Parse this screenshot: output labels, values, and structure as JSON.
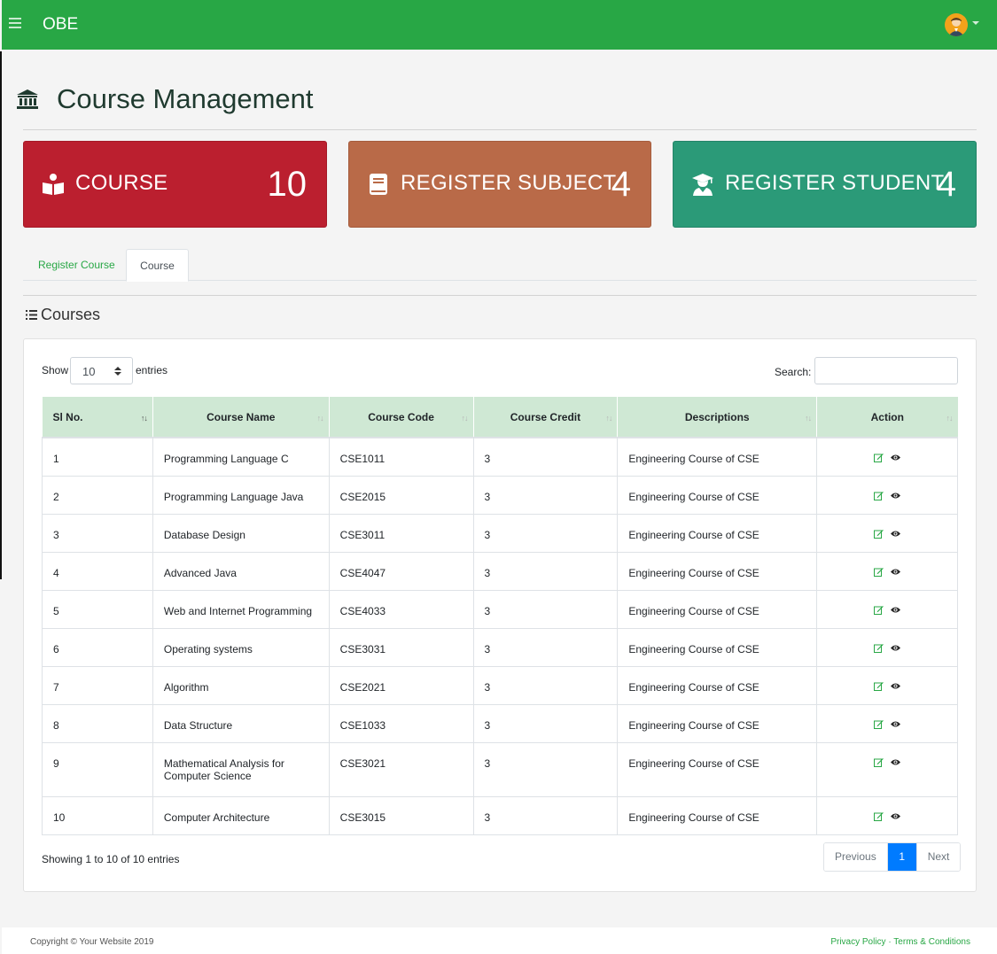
{
  "navbar": {
    "brand": "OBE",
    "menu_icon": "hamburger-icon",
    "avatar_icon": "user-avatar-icon"
  },
  "page": {
    "title": "Course Management",
    "title_icon": "bank-building-icon"
  },
  "cards": [
    {
      "label": "COURSE",
      "value": "10",
      "icon": "book-reader-icon",
      "color": "#bb1f2f"
    },
    {
      "label": "REGISTER SUBJECT",
      "value": "4",
      "icon": "book-icon",
      "color": "#b96a48"
    },
    {
      "label": "REGISTER STUDENT",
      "value": "4",
      "icon": "graduate-icon",
      "color": "#2b9a78"
    }
  ],
  "tabs": [
    {
      "label": "Register Course"
    },
    {
      "label": "Course",
      "active": true
    }
  ],
  "section": {
    "title": "Courses",
    "icon": "list-icon"
  },
  "table_controls": {
    "show_label": "Show",
    "page_length": "10",
    "entries_label": "entries",
    "search_label": "Search:",
    "search_value": ""
  },
  "table": {
    "headers": [
      "Sl No.",
      "Course Name",
      "Course Code",
      "Course Credit",
      "Descriptions",
      "Action"
    ],
    "rows": [
      {
        "sl": "1",
        "name": "Programming Language C",
        "code": "CSE1011",
        "credit": "3",
        "desc": "Engineering Course of CSE"
      },
      {
        "sl": "2",
        "name": "Programming Language Java",
        "code": "CSE2015",
        "credit": "3",
        "desc": "Engineering Course of CSE"
      },
      {
        "sl": "3",
        "name": "Database Design",
        "code": "CSE3011",
        "credit": "3",
        "desc": "Engineering Course of CSE"
      },
      {
        "sl": "4",
        "name": "Advanced Java",
        "code": "CSE4047",
        "credit": "3",
        "desc": "Engineering Course of CSE"
      },
      {
        "sl": "5",
        "name": "Web and Internet Programming",
        "code": "CSE4033",
        "credit": "3",
        "desc": "Engineering Course of CSE"
      },
      {
        "sl": "6",
        "name": "Operating systems",
        "code": "CSE3031",
        "credit": "3",
        "desc": "Engineering Course of CSE"
      },
      {
        "sl": "7",
        "name": "Algorithm",
        "code": "CSE2021",
        "credit": "3",
        "desc": "Engineering Course of CSE"
      },
      {
        "sl": "8",
        "name": "Data Structure",
        "code": "CSE1033",
        "credit": "3",
        "desc": "Engineering Course of CSE"
      },
      {
        "sl": "9",
        "name": "Mathematical Analysis for Computer Science",
        "code": "CSE3021",
        "credit": "3",
        "desc": "Engineering Course of CSE"
      },
      {
        "sl": "10",
        "name": "Computer Architecture",
        "code": "CSE3015",
        "credit": "3",
        "desc": "Engineering Course of CSE"
      }
    ],
    "action_icons": [
      "edit-icon",
      "view-eye-icon"
    ]
  },
  "pagination": {
    "info": "Showing 1 to 10 of 10 entries",
    "previous": "Previous",
    "current": "1",
    "next": "Next"
  },
  "footer": {
    "copyright": "Copyright © Your Website 2019",
    "privacy": "Privacy Policy",
    "separator": "·",
    "terms": "Terms & Conditions"
  },
  "colors": {
    "navbar": "#28a745",
    "link": "#28a745",
    "table_header": "#cfe8d4",
    "page_active": "#007bff"
  }
}
